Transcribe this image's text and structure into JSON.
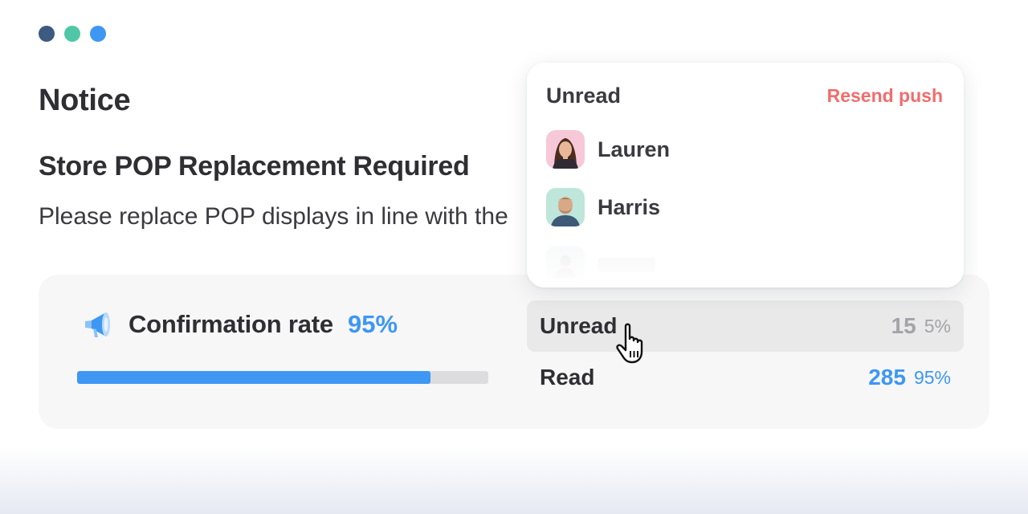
{
  "window": {
    "dot_colors": [
      "#3d5a80",
      "#4fc7a6",
      "#3d97f3"
    ]
  },
  "notice": {
    "title": "Notice",
    "subject": "Store POP Replacement Required",
    "body": "Please replace POP displays in line with the"
  },
  "confirmation": {
    "icon": "megaphone-icon",
    "label": "Confirmation rate",
    "rate_text": "95%",
    "rate_fraction": 0.86
  },
  "stats": [
    {
      "label": "Unread",
      "count": "15",
      "percent": "5%"
    },
    {
      "label": "Read",
      "count": "285",
      "percent": "95%"
    }
  ],
  "popover": {
    "title": "Unread",
    "action": "Resend push",
    "users": [
      {
        "name": "Lauren",
        "avatar": "avatar-lauren"
      },
      {
        "name": "Harris",
        "avatar": "avatar-harris"
      }
    ]
  },
  "colors": {
    "accent": "#3d97f3",
    "danger": "#f26c6c",
    "text": "#2e2e33"
  }
}
